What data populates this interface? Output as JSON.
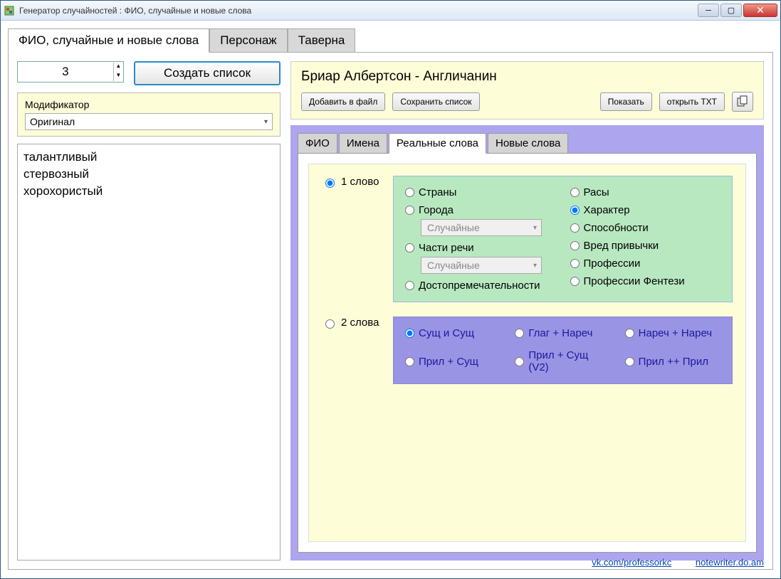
{
  "window": {
    "title": "Генератор случайностей : ФИО, случайные и новые слова"
  },
  "tabs": {
    "main": [
      "ФИО, случайные и новые слова",
      "Персонаж",
      "Таверна"
    ]
  },
  "left": {
    "count": "3",
    "create_btn": "Создать список",
    "modifier_label": "Модификатор",
    "modifier_value": "Оригинал",
    "results": [
      "талантливый",
      "стервозный",
      "хорохористый"
    ]
  },
  "header": {
    "title": "Бриар Албертсон - Англичанин",
    "add_file": "Добавить в файл",
    "save_list": "Сохранить список",
    "show": "Показать",
    "open_txt": "открыть TXT"
  },
  "subtabs": [
    "ФИО",
    "Имена",
    "Реальные слова",
    "Новые слова"
  ],
  "words": {
    "one_word": "1 слово",
    "two_words": "2 слова",
    "green_left": {
      "countries": "Страны",
      "cities": "Города",
      "cities_select": "Случайные",
      "parts": "Части речи",
      "parts_select": "Случайные",
      "sights": "Достопремечательности"
    },
    "green_right": {
      "races": "Расы",
      "character": "Характер",
      "abilities": "Способности",
      "habits": "Вред привычки",
      "professions": "Профессии",
      "professions_fantasy": "Профессии Фентези"
    },
    "purple": {
      "nn": "Сущ и Сущ",
      "vadv": "Глаг + Нареч",
      "advadv": "Нареч + Нареч",
      "adjn": "Прил + Сущ",
      "adjn2": "Прил + Сущ (V2)",
      "adjadj": "Прил ++ Прил"
    }
  },
  "footer": {
    "link1": "vk.com/professorkc",
    "link2": "notewriter.do.am"
  }
}
